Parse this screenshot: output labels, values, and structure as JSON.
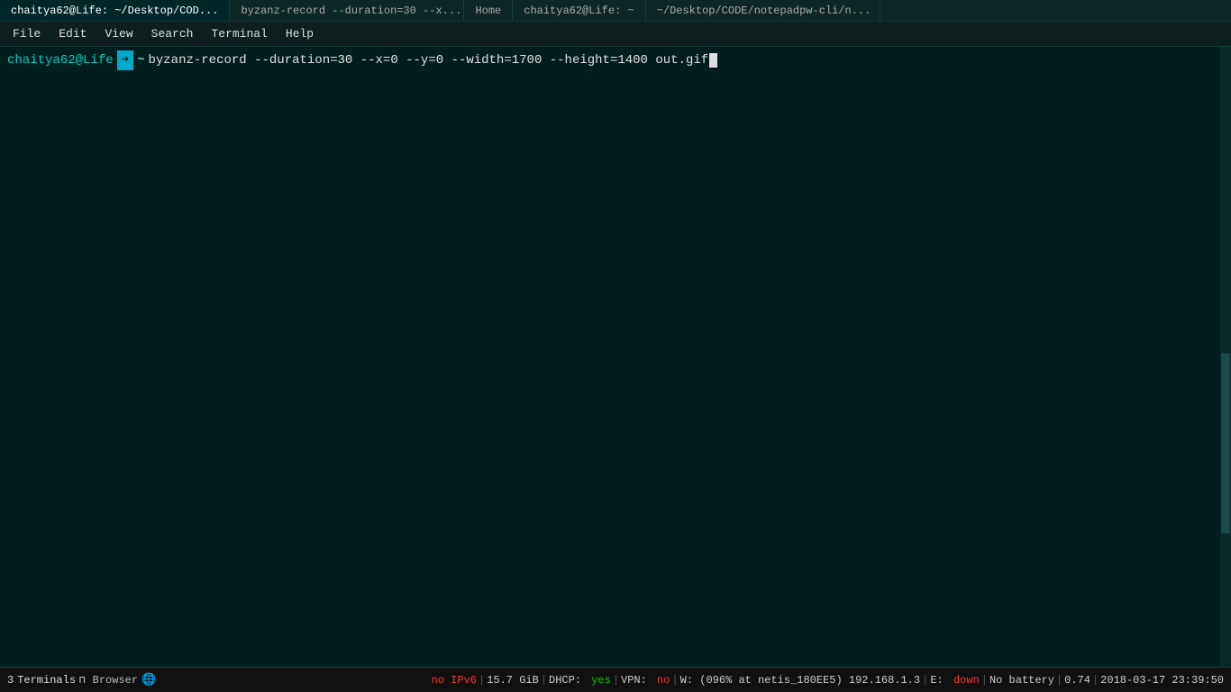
{
  "titlebar": {
    "tabs": [
      {
        "label": "chaitya62@Life: ~/Desktop/COD...",
        "active": true
      },
      {
        "label": "byzanz-record --duration=30 --x...",
        "active": false
      },
      {
        "label": "Home",
        "active": false
      },
      {
        "label": "chaitya62@Life: ~",
        "active": false
      },
      {
        "label": "~/Desktop/CODE/notepadpw-cli/n...",
        "active": false
      }
    ]
  },
  "menubar": {
    "items": [
      "File",
      "Edit",
      "View",
      "Search",
      "Terminal",
      "Help"
    ]
  },
  "terminal": {
    "prompt_user": "chaitya62@Life",
    "prompt_dir": "~",
    "command": "byzanz-record --duration=30 --x=0 --y=0 --width=1700 --height=1400 out.gif"
  },
  "statusbar": {
    "terminals_label": "Terminals",
    "terminals_count": "3",
    "pin_symbol": "⊓",
    "browser_label": "Browser",
    "no_ipv6": "no IPv6",
    "disk_size": "15.7 GiB",
    "dhcp_label": "DHCP:",
    "dhcp_val": "yes",
    "vpn_label": "VPN:",
    "vpn_val": "no",
    "wifi_info": "W: (096% at netis_180EE5) 192.168.1.3",
    "e_label": "E:",
    "e_val": "down",
    "battery_label": "No battery",
    "battery_val": "0.74",
    "datetime": "2018-03-17 23:39:50",
    "separator": "|"
  }
}
